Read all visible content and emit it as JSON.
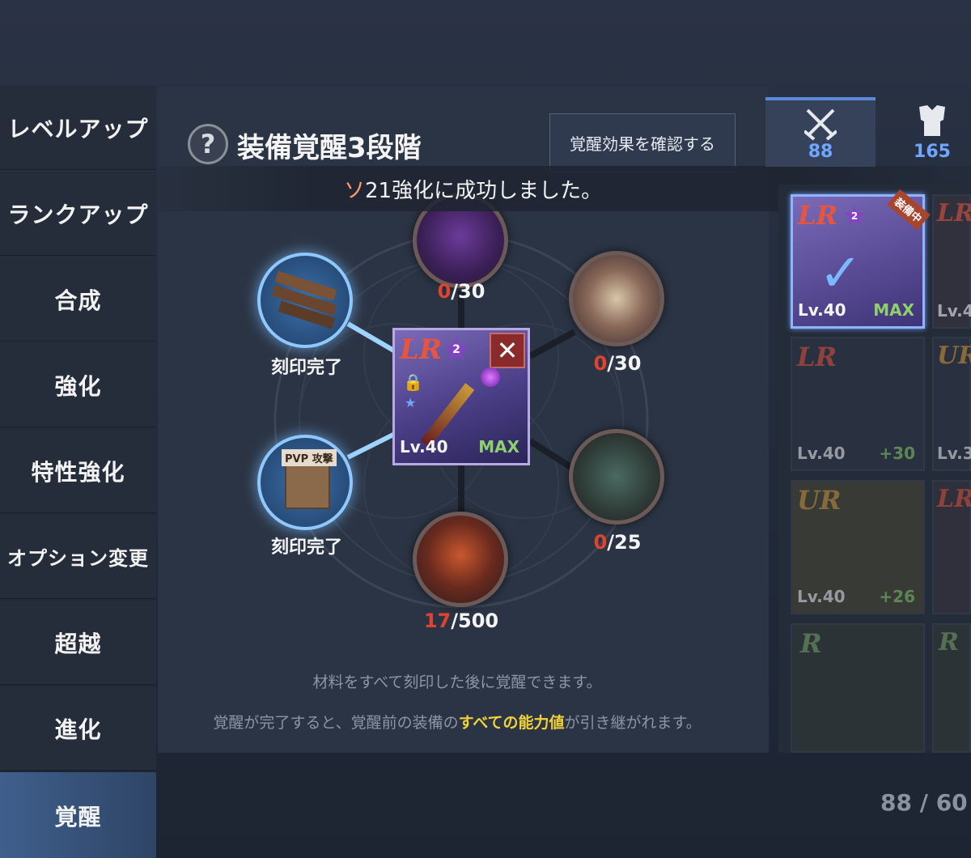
{
  "sidebar": {
    "items": [
      {
        "label": "レベルアップ"
      },
      {
        "label": "ランクアップ"
      },
      {
        "label": "合成"
      },
      {
        "label": "強化"
      },
      {
        "label": "特性強化"
      },
      {
        "label": "オプション変更"
      },
      {
        "label": "超越"
      },
      {
        "label": "進化"
      },
      {
        "label": "覚醒"
      }
    ],
    "active": "覚醒"
  },
  "header": {
    "help_icon": "question-icon",
    "title": "装備覚醒3段階",
    "effect_button": "覚醒効果を確認する"
  },
  "toast": {
    "prefix": "ソ",
    "message": "21強化に成功しました。"
  },
  "materials": {
    "top": {
      "current": "0",
      "total": "/30"
    },
    "right_top": {
      "current": "0",
      "total": "/30"
    },
    "right_bottom": {
      "current": "0",
      "total": "/25"
    },
    "bottom": {
      "current": "17",
      "total": "/500"
    },
    "left_top": {
      "label": "刻印完了"
    },
    "left_bottom": {
      "label": "刻印完了",
      "tag": "PVP 攻撃"
    }
  },
  "center_item": {
    "rank": "LR",
    "stars": "2",
    "level": "Lv.40",
    "status": "MAX",
    "close_icon": "close-icon"
  },
  "info": {
    "line1": "材料をすべて刻印した後に覚醒できます。",
    "line2_before": "覚醒が完了すると、覚醒前の装備の",
    "line2_highlight": "すべての能力値",
    "line2_after": "が引き継がれます。"
  },
  "tabs": [
    {
      "icon": "crossed-swords-icon",
      "count": "88"
    },
    {
      "icon": "armor-icon",
      "count": "165"
    }
  ],
  "inventory": {
    "slots": [
      {
        "rank": "LR",
        "stars": "2",
        "level": "Lv.40",
        "extra": "MAX",
        "badge": "装備中"
      },
      {
        "rank": "LR",
        "level": "Lv.4",
        "extra": ""
      },
      {
        "rank": "LR",
        "level": "Lv.40",
        "extra": "+30"
      },
      {
        "rank": "UR",
        "level": "Lv.3",
        "extra": ""
      },
      {
        "rank": "UR",
        "level": "Lv.40",
        "extra": "+26"
      },
      {
        "rank": "LR",
        "level": "",
        "extra": ""
      },
      {
        "rank": "R",
        "level": "",
        "extra": ""
      },
      {
        "rank": "R",
        "level": "",
        "extra": ""
      }
    ],
    "footer": "88 / 60"
  },
  "colors": {
    "accent_blue": "#6fa7ff",
    "max_green": "#8ed16a",
    "count_red": "#e0442f",
    "highlight_yellow": "#f1d23b"
  }
}
